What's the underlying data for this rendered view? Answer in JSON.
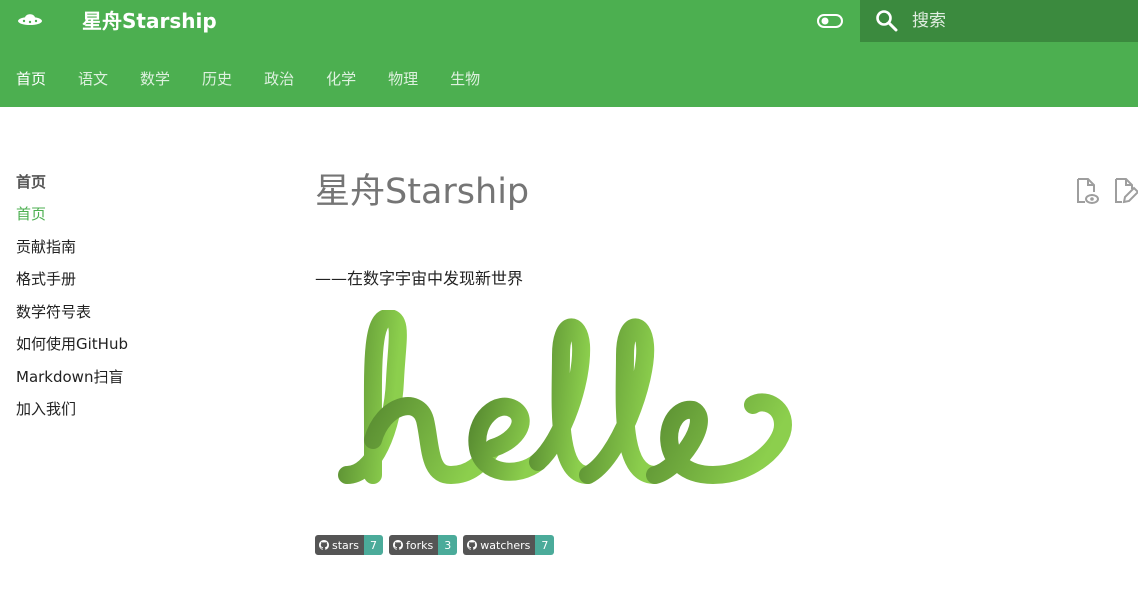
{
  "header": {
    "logo_icon": "ufo-icon",
    "title": "星舟Starship",
    "theme_toggle_icon": "toggle-icon",
    "search": {
      "icon": "search-icon",
      "placeholder": "搜索",
      "value": ""
    }
  },
  "tabs": [
    {
      "label": "首页",
      "active": true
    },
    {
      "label": "语文",
      "active": false
    },
    {
      "label": "数学",
      "active": false
    },
    {
      "label": "历史",
      "active": false
    },
    {
      "label": "政治",
      "active": false
    },
    {
      "label": "化学",
      "active": false
    },
    {
      "label": "物理",
      "active": false
    },
    {
      "label": "生物",
      "active": false
    }
  ],
  "sidebar": {
    "title": "首页",
    "items": [
      {
        "label": "首页",
        "active": true
      },
      {
        "label": "贡献指南",
        "active": false
      },
      {
        "label": "格式手册",
        "active": false
      },
      {
        "label": "数学符号表",
        "active": false
      },
      {
        "label": "如何使用GitHub",
        "active": false
      },
      {
        "label": "Markdown扫盲",
        "active": false
      },
      {
        "label": "加入我们",
        "active": false
      }
    ]
  },
  "content": {
    "title": "星舟Starship",
    "subtitle": "——在数字宇宙中发现新世界",
    "image_text": "hello",
    "actions": [
      "view-source-icon",
      "edit-page-icon"
    ]
  },
  "badges": [
    {
      "label": "stars",
      "count": "7",
      "icon": "github-icon"
    },
    {
      "label": "forks",
      "count": "3",
      "icon": "github-icon"
    },
    {
      "label": "watchers",
      "count": "7",
      "icon": "github-icon"
    }
  ],
  "colors": {
    "primary": "#4caf50",
    "search_bg": "#3b8a3e",
    "badge_left": "#555555",
    "badge_right": "#4bab9a",
    "hello_gradient_start": "#5a8e32",
    "hello_gradient_end": "#8ccf4d"
  }
}
